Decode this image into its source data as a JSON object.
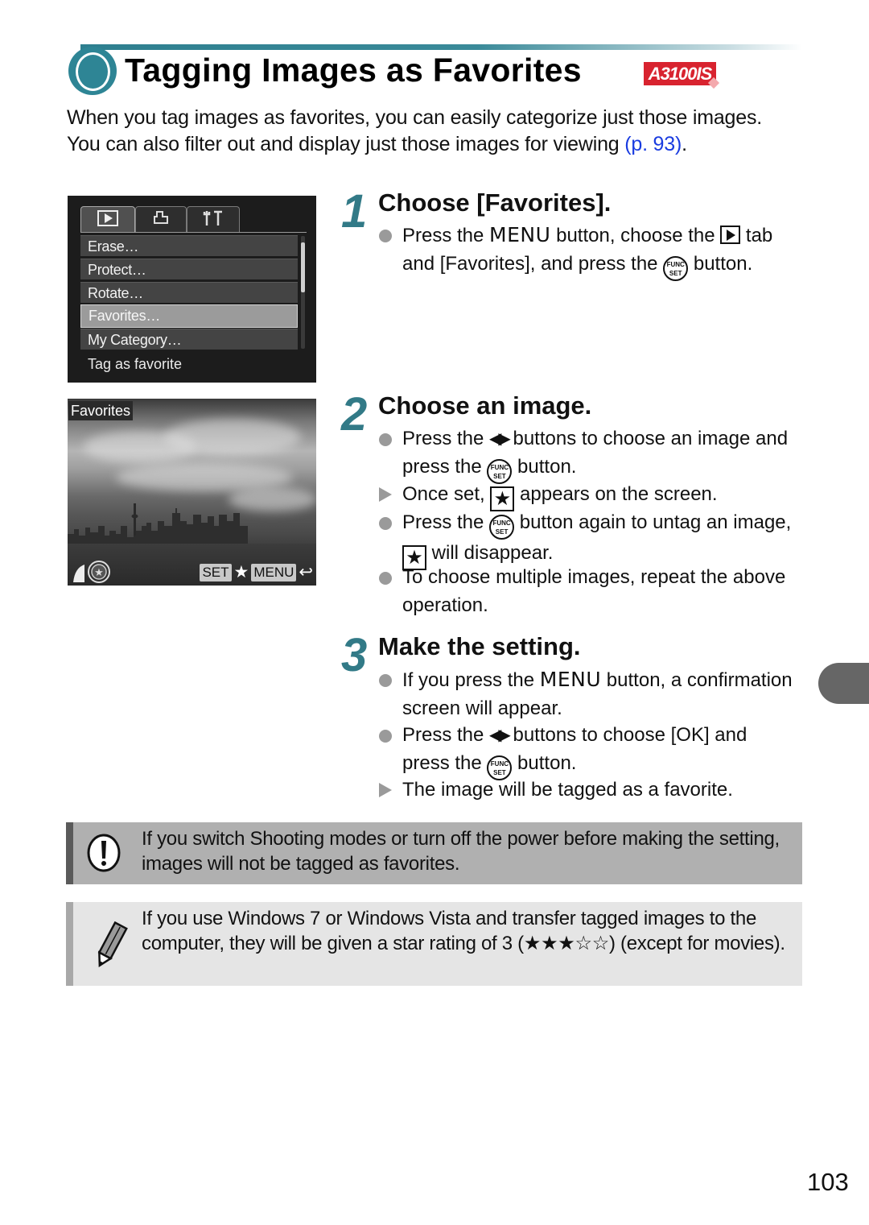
{
  "header": {
    "title": "Tagging Images as Favorites",
    "model_badge": "A3100IS",
    "accent_color": "#2e8595",
    "badge_color": "#d8232f"
  },
  "intro": {
    "text": "When you tag images as favorites, you can easily categorize just those images. You can also filter out and display just those images for viewing ",
    "xref": "(p. 93)",
    "tail": "."
  },
  "camera_menu": {
    "tabs": [
      {
        "icon": "playback-tab-icon",
        "glyph": "▶",
        "active": true
      },
      {
        "icon": "print-tab-icon",
        "glyph": "⎙",
        "active": false
      },
      {
        "icon": "settings-tab-icon",
        "glyph": "ΨΤ",
        "active": false
      }
    ],
    "items": [
      {
        "label": "Erase…",
        "selected": false
      },
      {
        "label": "Protect…",
        "selected": false
      },
      {
        "label": "Rotate…",
        "selected": false
      },
      {
        "label": "Favorites…",
        "selected": true
      },
      {
        "label": "My Category…",
        "selected": false
      }
    ],
    "hint": "Tag as favorite"
  },
  "camera_photo": {
    "label": "Favorites",
    "set_key": "SET",
    "star": "★",
    "menu_key": "MENU",
    "return": "⮌"
  },
  "steps": [
    {
      "number": "1",
      "title": "Choose [Favorites].",
      "bullets": [
        {
          "type": "dot",
          "parts": {
            "a": "Press the ",
            "menu": "MENU",
            "b": " button, choose the ",
            "c": " tab and [Favorites], and press the ",
            "d": " button."
          }
        }
      ]
    },
    {
      "number": "2",
      "title": "Choose an image.",
      "bullets": [
        {
          "type": "dot",
          "parts": {
            "a": "Press the ",
            "b": " buttons to choose an image and press the ",
            "c": " button."
          }
        },
        {
          "type": "result",
          "parts": {
            "a": "Once set, ",
            "b": " appears on the screen."
          }
        },
        {
          "type": "dot",
          "parts": {
            "a": "Press the ",
            "b": " button again to untag an image, ",
            "c": " will disappear."
          }
        },
        {
          "type": "dot",
          "parts": {
            "a": "To choose multiple images, repeat the above operation."
          }
        }
      ]
    },
    {
      "number": "3",
      "title": "Make the setting.",
      "bullets": [
        {
          "type": "dot",
          "parts": {
            "a": "If you press the ",
            "menu": "MENU",
            "b": " button, a confirmation screen will appear."
          }
        },
        {
          "type": "dot",
          "parts": {
            "a": "Press the ",
            "b": " buttons to choose [OK] and press the ",
            "c": " button."
          }
        },
        {
          "type": "result",
          "parts": {
            "a": "The image will be tagged as a favorite."
          }
        }
      ]
    }
  ],
  "icons": {
    "func_set_top": "FUNC",
    "func_set_bottom": "SET",
    "left_right": "◀▶",
    "star": "★"
  },
  "notes": {
    "caution": "If you switch Shooting modes or turn off the power before making the setting, images will not be tagged as favorites.",
    "tip": "If you use Windows 7 or Windows Vista and transfer tagged images to the computer, they will be given a star rating of 3 (★★★☆☆) (except for movies)."
  },
  "footer": {
    "page_number": "103"
  }
}
